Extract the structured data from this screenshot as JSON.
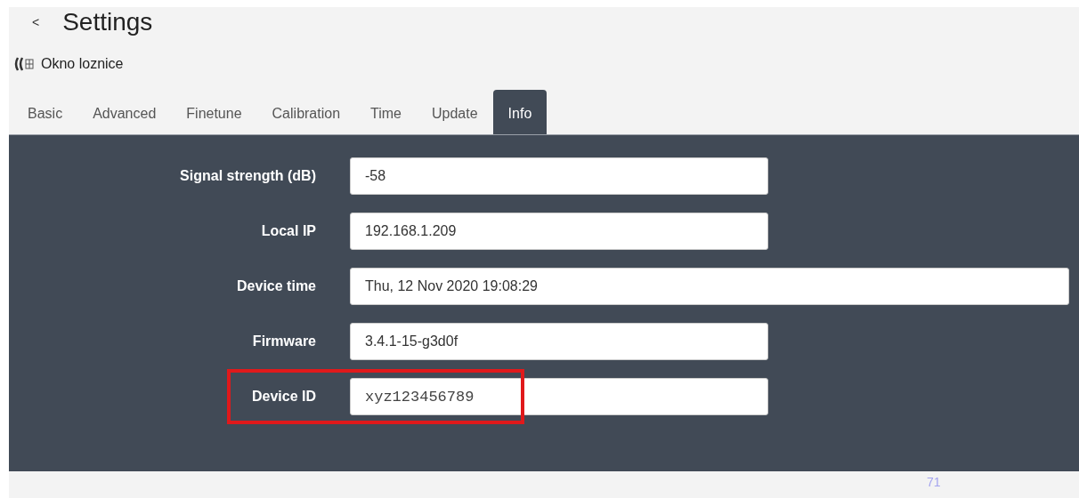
{
  "header": {
    "back": "<",
    "title": "Settings"
  },
  "device": {
    "name": "Okno loznice"
  },
  "tabs": [
    {
      "label": "Basic",
      "selected": false
    },
    {
      "label": "Advanced",
      "selected": false
    },
    {
      "label": "Finetune",
      "selected": false
    },
    {
      "label": "Calibration",
      "selected": false
    },
    {
      "label": "Time",
      "selected": false
    },
    {
      "label": "Update",
      "selected": false
    },
    {
      "label": "Info",
      "selected": true
    }
  ],
  "fields": [
    {
      "label": "Signal strength (dB)",
      "value": "-58",
      "kind": "normal",
      "highlighted": false
    },
    {
      "label": "Local IP",
      "value": "192.168.1.209",
      "kind": "normal",
      "highlighted": false
    },
    {
      "label": "Device time",
      "value": "Thu, 12 Nov 2020 19:08:29",
      "kind": "wide",
      "highlighted": false
    },
    {
      "label": "Firmware",
      "value": "3.4.1-15-g3d0f",
      "kind": "normal",
      "highlighted": false
    },
    {
      "label": "Device ID",
      "value": "xyz123456789",
      "kind": "mono",
      "highlighted": true
    }
  ],
  "footer": {
    "text": "71"
  }
}
